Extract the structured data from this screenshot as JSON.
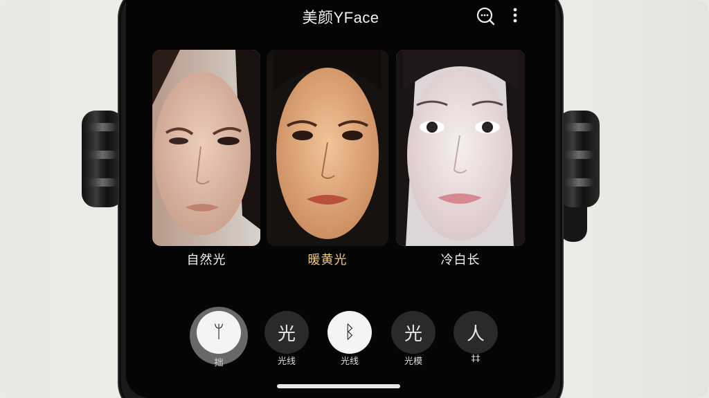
{
  "header": {
    "title": "美颜YFace",
    "search_icon": "search-chat-icon",
    "more_icon": "more-vertical-icon"
  },
  "presets": [
    {
      "label": "自然光",
      "active": false
    },
    {
      "label": "暖黄光",
      "active": true
    },
    {
      "label": "冷白长",
      "active": false
    }
  ],
  "tools": [
    {
      "glyph": "ᛘ",
      "label": "拙",
      "selected": true
    },
    {
      "glyph": "光",
      "label": "光线",
      "selected": false
    },
    {
      "glyph": "ᛒ",
      "label": "光线",
      "selected": true
    },
    {
      "glyph": "光",
      "label": "光模",
      "selected": false
    },
    {
      "glyph": "人",
      "label": "‡‡",
      "selected": false
    }
  ],
  "colors": {
    "active_label": "#f1c97a",
    "screen_bg": "#050505"
  }
}
